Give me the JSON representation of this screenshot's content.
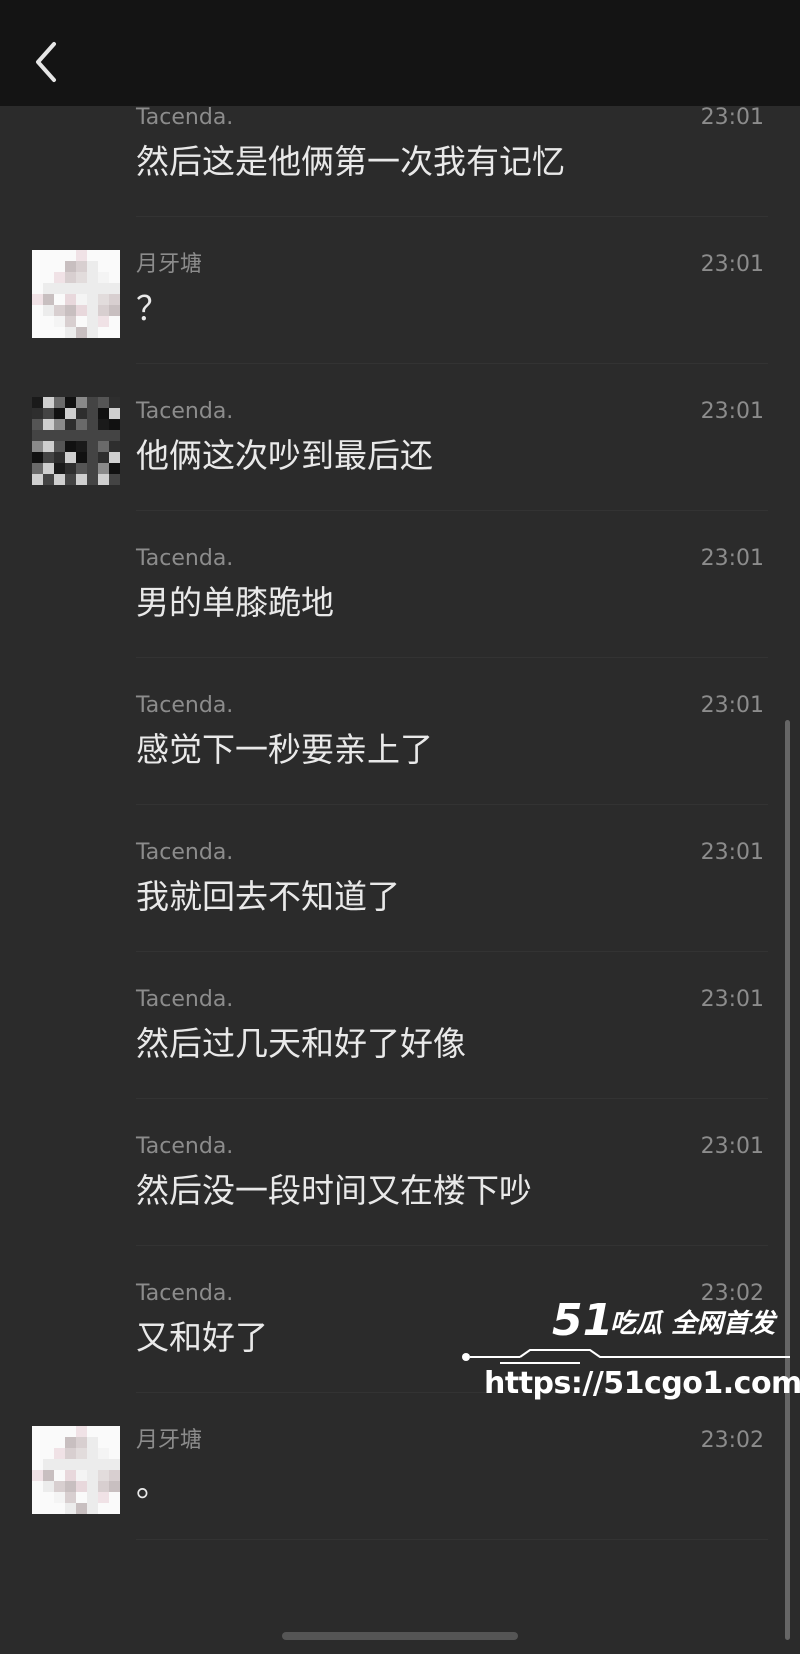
{
  "header": {
    "back_icon": "chevron-left-icon"
  },
  "messages": [
    {
      "sender": "Tacenda.",
      "time": "23:01",
      "text": "然后这是他俩第一次我有记忆",
      "avatar": false
    },
    {
      "sender": "月牙塘",
      "time": "23:01",
      "text": "？",
      "avatar": "light"
    },
    {
      "sender": "Tacenda.",
      "time": "23:01",
      "text": "他俩这次吵到最后还",
      "avatar": "dark"
    },
    {
      "sender": "Tacenda.",
      "time": "23:01",
      "text": "男的单膝跪地",
      "avatar": false
    },
    {
      "sender": "Tacenda.",
      "time": "23:01",
      "text": "感觉下一秒要亲上了",
      "avatar": false
    },
    {
      "sender": "Tacenda.",
      "time": "23:01",
      "text": "我就回去不知道了",
      "avatar": false
    },
    {
      "sender": "Tacenda.",
      "time": "23:01",
      "text": "然后过几天和好了好像",
      "avatar": false
    },
    {
      "sender": "Tacenda.",
      "time": "23:01",
      "text": "然后没一段时间又在楼下吵",
      "avatar": false
    },
    {
      "sender": "Tacenda.",
      "time": "23:02",
      "text": "又和好了",
      "avatar": false
    },
    {
      "sender": "月牙塘",
      "time": "23:02",
      "text": "。",
      "avatar": "light"
    }
  ],
  "watermark": {
    "logo": "51",
    "tagline": "吃瓜 全网首发",
    "url": "https://51cgo1.com"
  },
  "colors": {
    "background": "#2b2b2b",
    "topbar": "#141414",
    "meta_text": "#8c8c8c",
    "message_text": "#e9e9e9"
  }
}
